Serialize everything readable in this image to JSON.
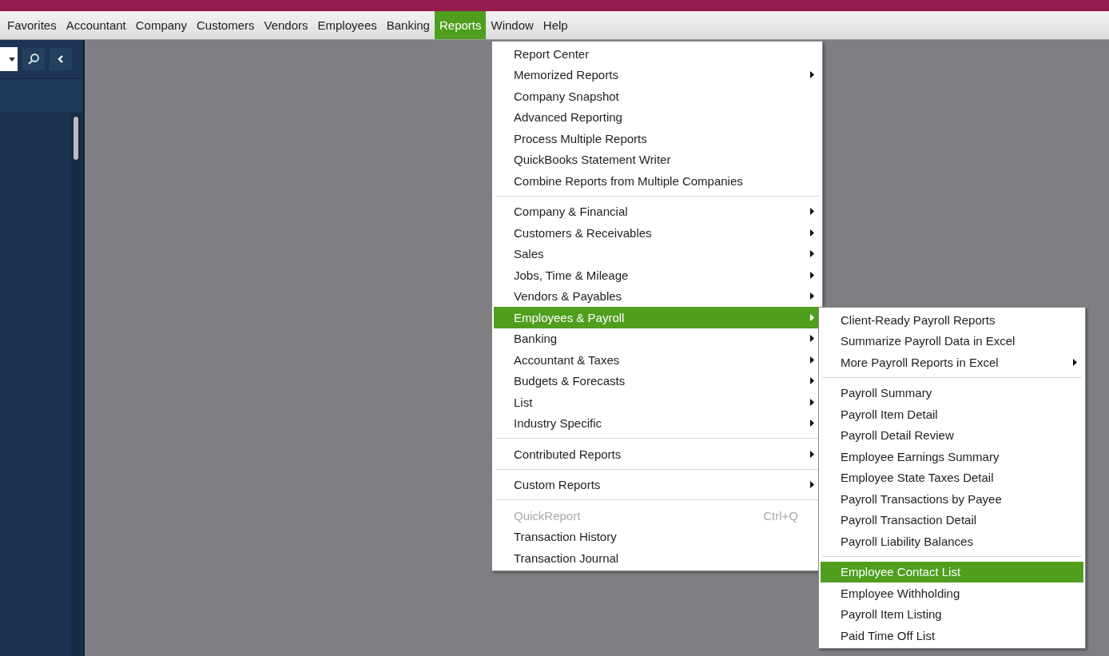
{
  "menubar": [
    {
      "label": "Favorites",
      "selected": false
    },
    {
      "label": "Accountant",
      "selected": false
    },
    {
      "label": "Company",
      "selected": false
    },
    {
      "label": "Customers",
      "selected": false
    },
    {
      "label": "Vendors",
      "selected": false
    },
    {
      "label": "Employees",
      "selected": false
    },
    {
      "label": "Banking",
      "selected": false
    },
    {
      "label": "Reports",
      "selected": true
    },
    {
      "label": "Window",
      "selected": false
    },
    {
      "label": "Help",
      "selected": false
    }
  ],
  "reports_menu": [
    {
      "kind": "item",
      "label": "Report Center",
      "selected": false,
      "disabled": false,
      "submenu": false
    },
    {
      "kind": "item",
      "label": "Memorized Reports",
      "selected": false,
      "disabled": false,
      "submenu": true
    },
    {
      "kind": "item",
      "label": "Company Snapshot",
      "selected": false,
      "disabled": false,
      "submenu": false
    },
    {
      "kind": "item",
      "label": "Advanced Reporting",
      "selected": false,
      "disabled": false,
      "submenu": false
    },
    {
      "kind": "item",
      "label": "Process Multiple Reports",
      "selected": false,
      "disabled": false,
      "submenu": false
    },
    {
      "kind": "item",
      "label": "QuickBooks Statement Writer",
      "selected": false,
      "disabled": false,
      "submenu": false
    },
    {
      "kind": "item",
      "label": "Combine Reports from Multiple Companies",
      "selected": false,
      "disabled": false,
      "submenu": false
    },
    {
      "kind": "separator"
    },
    {
      "kind": "item",
      "label": "Company & Financial",
      "selected": false,
      "disabled": false,
      "submenu": true
    },
    {
      "kind": "item",
      "label": "Customers & Receivables",
      "selected": false,
      "disabled": false,
      "submenu": true
    },
    {
      "kind": "item",
      "label": "Sales",
      "selected": false,
      "disabled": false,
      "submenu": true
    },
    {
      "kind": "item",
      "label": "Jobs, Time & Mileage",
      "selected": false,
      "disabled": false,
      "submenu": true
    },
    {
      "kind": "item",
      "label": "Vendors & Payables",
      "selected": false,
      "disabled": false,
      "submenu": true
    },
    {
      "kind": "item",
      "label": "Employees & Payroll",
      "selected": true,
      "disabled": false,
      "submenu": true
    },
    {
      "kind": "item",
      "label": "Banking",
      "selected": false,
      "disabled": false,
      "submenu": true
    },
    {
      "kind": "item",
      "label": "Accountant & Taxes",
      "selected": false,
      "disabled": false,
      "submenu": true
    },
    {
      "kind": "item",
      "label": "Budgets & Forecasts",
      "selected": false,
      "disabled": false,
      "submenu": true
    },
    {
      "kind": "item",
      "label": "List",
      "selected": false,
      "disabled": false,
      "submenu": true
    },
    {
      "kind": "item",
      "label": "Industry Specific",
      "selected": false,
      "disabled": false,
      "submenu": true
    },
    {
      "kind": "separator"
    },
    {
      "kind": "item",
      "label": "Contributed Reports",
      "selected": false,
      "disabled": false,
      "submenu": true
    },
    {
      "kind": "separator"
    },
    {
      "kind": "item",
      "label": "Custom Reports",
      "selected": false,
      "disabled": false,
      "submenu": true
    },
    {
      "kind": "separator"
    },
    {
      "kind": "item",
      "label": "QuickReport",
      "shortcut": "Ctrl+Q",
      "selected": false,
      "disabled": true,
      "submenu": false
    },
    {
      "kind": "item",
      "label": "Transaction History",
      "selected": false,
      "disabled": false,
      "submenu": false
    },
    {
      "kind": "item",
      "label": "Transaction Journal",
      "selected": false,
      "disabled": false,
      "submenu": false
    }
  ],
  "payroll_submenu": [
    {
      "kind": "item",
      "label": "Client-Ready Payroll Reports",
      "selected": false,
      "disabled": false,
      "submenu": false
    },
    {
      "kind": "item",
      "label": "Summarize Payroll Data in Excel",
      "selected": false,
      "disabled": false,
      "submenu": false
    },
    {
      "kind": "item",
      "label": "More Payroll Reports in Excel",
      "selected": false,
      "disabled": false,
      "submenu": true
    },
    {
      "kind": "separator"
    },
    {
      "kind": "item",
      "label": "Payroll Summary",
      "selected": false,
      "disabled": false,
      "submenu": false
    },
    {
      "kind": "item",
      "label": "Payroll Item Detail",
      "selected": false,
      "disabled": false,
      "submenu": false
    },
    {
      "kind": "item",
      "label": "Payroll Detail Review",
      "selected": false,
      "disabled": false,
      "submenu": false
    },
    {
      "kind": "item",
      "label": "Employee Earnings Summary",
      "selected": false,
      "disabled": false,
      "submenu": false
    },
    {
      "kind": "item",
      "label": "Employee State Taxes Detail",
      "selected": false,
      "disabled": false,
      "submenu": false
    },
    {
      "kind": "item",
      "label": "Payroll Transactions by Payee",
      "selected": false,
      "disabled": false,
      "submenu": false
    },
    {
      "kind": "item",
      "label": "Payroll Transaction Detail",
      "selected": false,
      "disabled": false,
      "submenu": false
    },
    {
      "kind": "item",
      "label": "Payroll Liability Balances",
      "selected": false,
      "disabled": false,
      "submenu": false
    },
    {
      "kind": "separator"
    },
    {
      "kind": "item",
      "label": "Employee Contact List",
      "selected": true,
      "disabled": false,
      "submenu": false
    },
    {
      "kind": "item",
      "label": "Employee Withholding",
      "selected": false,
      "disabled": false,
      "submenu": false
    },
    {
      "kind": "item",
      "label": "Payroll Item Listing",
      "selected": false,
      "disabled": false,
      "submenu": false
    },
    {
      "kind": "item",
      "label": "Paid Time Off List",
      "selected": false,
      "disabled": false,
      "submenu": false
    }
  ]
}
